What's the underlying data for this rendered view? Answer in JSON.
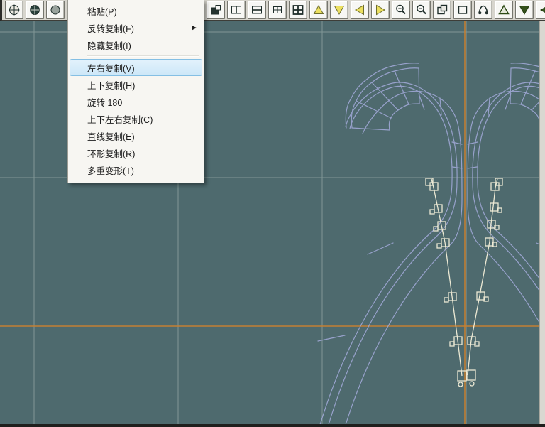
{
  "colors": {
    "bg_canvas": "#4e6a6e",
    "grid_line": "#9db0ac",
    "axis_orange": "#c8802f",
    "design_line": "#a0a8d6",
    "selection_line": "#ece9d4",
    "toolbar_bg": "#d7d5cd",
    "button_face": "#f7f7f4",
    "menu_bg": "#f7f6f2",
    "menu_border": "#9b9b93",
    "menu_text": "#1b1b1b",
    "menu_highlight_bg": "#cde7f8",
    "menu_highlight_border": "#84bfe4",
    "icon_yellow": "#ece060",
    "icon_green": "#35521c"
  },
  "menu": {
    "submenu_arrow": "▶",
    "items": [
      {
        "label": "粘贴(P)"
      },
      {
        "label": "反转复制(F)",
        "submenu": true
      },
      {
        "label": "隐藏复制(I)"
      },
      {
        "separator": true
      },
      {
        "label": "左右复制(V)",
        "highlighted": true
      },
      {
        "label": "上下复制(H)"
      },
      {
        "label": "旋转 180"
      },
      {
        "label": "上下左右复制(C)"
      },
      {
        "label": "直线复制(E)"
      },
      {
        "label": "环形复制(R)"
      },
      {
        "label": "多重变形(T)"
      }
    ]
  },
  "toolbar": {
    "left_buttons": [
      {
        "name": "design-origin",
        "icon": "circle-cross"
      },
      {
        "name": "stitch-origin",
        "icon": "circle-cross-dark"
      },
      {
        "name": "circle-mark",
        "icon": "circle-gray"
      }
    ],
    "right_buttons": [
      {
        "name": "window-dark",
        "icon": "window-dark"
      },
      {
        "name": "overlap-windows",
        "icon": "overlap-squares"
      },
      {
        "name": "split-vertical",
        "icon": "split-v"
      },
      {
        "name": "split-horizontal",
        "icon": "split-h"
      },
      {
        "name": "grid-four",
        "icon": "grid-small"
      },
      {
        "name": "grid-four-bold",
        "icon": "grid-bold"
      },
      {
        "name": "move-up-yellow",
        "icon": "tri-up-y"
      },
      {
        "name": "move-down-yellow",
        "icon": "tri-down-y"
      },
      {
        "name": "move-left-yellow",
        "icon": "tri-left-y"
      },
      {
        "name": "move-right-yellow",
        "icon": "tri-right-y"
      },
      {
        "name": "zoom-in",
        "icon": "zoom-in"
      },
      {
        "name": "zoom-out",
        "icon": "zoom-out"
      },
      {
        "name": "zoom-region",
        "icon": "zoom-region"
      },
      {
        "name": "select-box",
        "icon": "square-outline"
      },
      {
        "name": "fit-view",
        "icon": "fit-view"
      },
      {
        "name": "step-up-green",
        "icon": "tri-up-g"
      },
      {
        "name": "step-down-green",
        "icon": "tri-down-g"
      },
      {
        "name": "step-left-green",
        "icon": "tri-left-g"
      }
    ]
  }
}
